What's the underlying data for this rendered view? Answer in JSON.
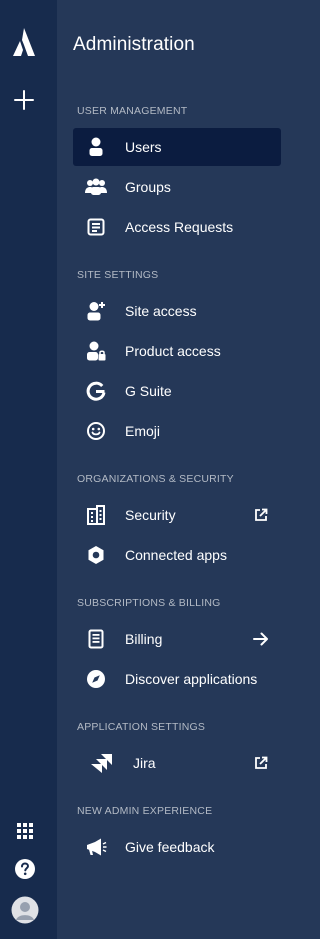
{
  "global_nav": {
    "logo_icon": "atlassian-logo-icon",
    "create_icon": "plus-icon",
    "apps_icon": "app-switcher-icon",
    "help_icon": "help-icon",
    "profile_icon": "avatar-icon"
  },
  "panel": {
    "title": "Administration"
  },
  "sections": {
    "user_management": "USER MANAGEMENT",
    "site_settings": "SITE SETTINGS",
    "orgs_security": "ORGANIZATIONS & SECURITY",
    "subs_billing": "SUBSCRIPTIONS & BILLING",
    "app_settings": "APPLICATION SETTINGS",
    "new_admin": "NEW ADMIN EXPERIENCE"
  },
  "items": {
    "users": {
      "label": "Users",
      "icon": "person-icon",
      "selected": true
    },
    "groups": {
      "label": "Groups",
      "icon": "people-group-icon"
    },
    "access_requests": {
      "label": "Access Requests",
      "icon": "document-icon"
    },
    "site_access": {
      "label": "Site access",
      "icon": "person-add-icon"
    },
    "product_access": {
      "label": "Product access",
      "icon": "person-lock-icon"
    },
    "g_suite": {
      "label": "G Suite",
      "icon": "google-icon"
    },
    "emoji": {
      "label": "Emoji",
      "icon": "emoji-icon"
    },
    "security": {
      "label": "Security",
      "icon": "building-icon",
      "trailing_icon": "external-link-icon"
    },
    "connected_apps": {
      "label": "Connected apps",
      "icon": "hexagon-icon"
    },
    "billing": {
      "label": "Billing",
      "icon": "receipt-icon",
      "trailing_icon": "arrow-right-icon"
    },
    "discover": {
      "label": "Discover applications",
      "icon": "compass-icon"
    },
    "jira": {
      "label": "Jira",
      "icon": "jira-icon",
      "trailing_icon": "external-link-icon"
    },
    "feedback": {
      "label": "Give feedback",
      "icon": "megaphone-icon"
    }
  },
  "colors": {
    "global_nav_bg": "#172b4d",
    "panel_bg": "#253858",
    "selected_bg": "#0b1c40",
    "section_text": "#b3bac5",
    "text": "#ffffff"
  }
}
